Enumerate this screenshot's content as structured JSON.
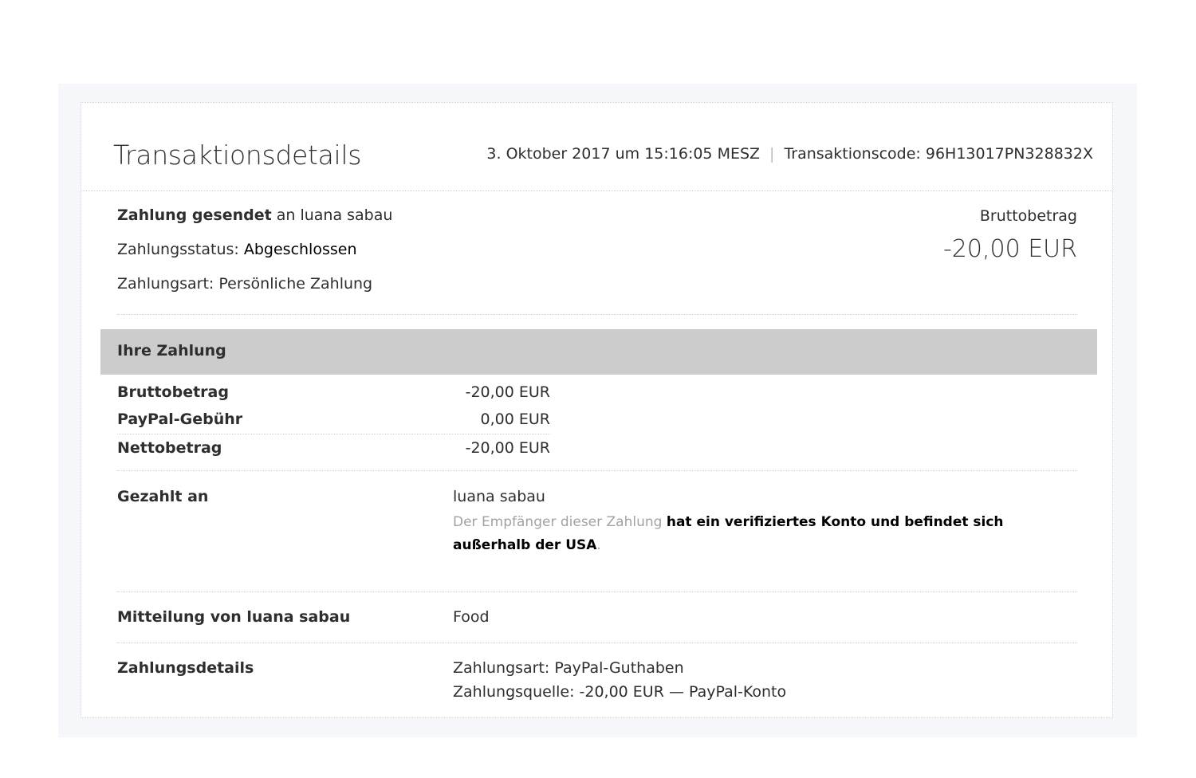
{
  "header": {
    "title": "Transaktionsdetails",
    "date": "3. Oktober 2017 um 15:16:05 MESZ",
    "separator": "|",
    "transaction_code": "Transaktionscode: 96H13017PN328832X"
  },
  "summary": {
    "sent_bold": "Zahlung gesendet",
    "sent_rest": " an luana sabau",
    "status_label": "Zahlungsstatus: ",
    "status_value": "Abgeschlossen",
    "type": "Zahlungsart: Persönliche Zahlung",
    "gross_label": "Bruttobetrag",
    "gross_amount": "-20,00 EUR"
  },
  "payment": {
    "section_title": "Ihre Zahlung",
    "rows": [
      {
        "label": "Bruttobetrag",
        "amount": "-20,00 EUR"
      },
      {
        "label": "PayPal-Gebühr",
        "amount": "0,00 EUR"
      },
      {
        "label": "Nettobetrag",
        "amount": "-20,00 EUR"
      }
    ]
  },
  "paid_to": {
    "label": "Gezahlt an",
    "name": "luana sabau",
    "note_prefix": "Der Empfänger dieser Zahlung ",
    "note_bold": "hat ein verifiziertes Konto und befindet sich außerhalb der USA",
    "note_suffix": "."
  },
  "message": {
    "label": "Mitteilung von luana sabau",
    "value": "Food"
  },
  "details": {
    "label": "Zahlungsdetails",
    "method": "Zahlungsart: PayPal-Guthaben",
    "source": "Zahlungsquelle: -20,00 EUR — PayPal-Konto"
  }
}
